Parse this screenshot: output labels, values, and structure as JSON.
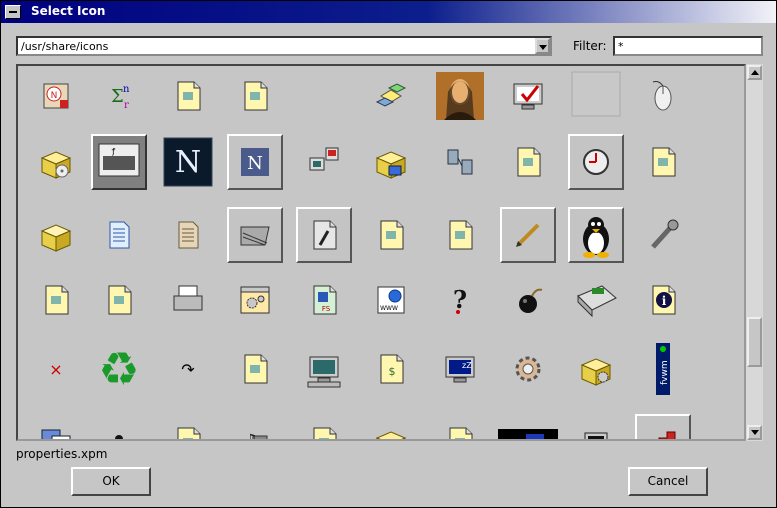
{
  "window": {
    "title": "Select Icon"
  },
  "path": {
    "value": "/usr/share/icons"
  },
  "filter": {
    "label": "Filter:",
    "value": "*"
  },
  "icons": [
    {
      "name": "compass-box-icon",
      "style": "plain"
    },
    {
      "name": "math-sigma-icon",
      "style": "plain",
      "text": "Σ",
      "sup": "n",
      "sub": "r"
    },
    {
      "name": "doc-bug-icon",
      "style": "plain"
    },
    {
      "name": "doc-grid-icon",
      "style": "plain"
    },
    {
      "name": "empty-slot",
      "style": "plain"
    },
    {
      "name": "cubes-icon",
      "style": "plain"
    },
    {
      "name": "mona-lisa-icon",
      "style": "plain"
    },
    {
      "name": "monitor-check-icon",
      "style": "plain"
    },
    {
      "name": "blank-card-icon",
      "style": "plain"
    },
    {
      "name": "mouse-icon",
      "style": "plain"
    },
    {
      "name": "package-cd-icon",
      "style": "plain"
    },
    {
      "name": "hardware-keyboard-icon",
      "style": "selected"
    },
    {
      "name": "netscape-icon",
      "style": "plain",
      "text": "N"
    },
    {
      "name": "netscape-small-icon",
      "style": "button",
      "text": "N"
    },
    {
      "name": "network-computers-icon",
      "style": "plain"
    },
    {
      "name": "package-monitor-icon",
      "style": "plain"
    },
    {
      "name": "network-servers-icon",
      "style": "plain"
    },
    {
      "name": "doc-yellow-icon",
      "style": "plain"
    },
    {
      "name": "clock-icon",
      "style": "button"
    },
    {
      "name": "doc-yellow-2-icon",
      "style": "plain"
    },
    {
      "name": "open-box-icon",
      "style": "plain"
    },
    {
      "name": "text-file-icon",
      "style": "plain"
    },
    {
      "name": "document-icon",
      "style": "plain"
    },
    {
      "name": "desk-icon",
      "style": "button"
    },
    {
      "name": "file-pen-icon",
      "style": "button"
    },
    {
      "name": "hand-doc-icon",
      "style": "plain"
    },
    {
      "name": "pdf-doc-icon",
      "style": "plain"
    },
    {
      "name": "pencil-icon",
      "style": "button"
    },
    {
      "name": "tux-penguin-icon",
      "style": "button"
    },
    {
      "name": "wrench-icon",
      "style": "plain"
    },
    {
      "name": "gnome-foot-icon",
      "style": "plain"
    },
    {
      "name": "doc-hand-icon",
      "style": "plain"
    },
    {
      "name": "printer-icon",
      "style": "plain"
    },
    {
      "name": "window-gears-icon",
      "style": "plain"
    },
    {
      "name": "fs-doc-icon",
      "style": "plain",
      "text": "FS"
    },
    {
      "name": "www-doc-icon",
      "style": "plain",
      "text": "WWW"
    },
    {
      "name": "help-question-icon",
      "style": "plain",
      "text": "?"
    },
    {
      "name": "bomb-icon",
      "style": "plain"
    },
    {
      "name": "calculator-icon",
      "style": "plain"
    },
    {
      "name": "info-doc-icon",
      "style": "plain",
      "text": "i"
    },
    {
      "name": "close-x-icon",
      "style": "plain",
      "text": "×"
    },
    {
      "name": "recycle-icon",
      "style": "plain",
      "text": "♻"
    },
    {
      "name": "curved-arrow-icon",
      "style": "plain",
      "text": "↷"
    },
    {
      "name": "doc-screen-icon",
      "style": "plain"
    },
    {
      "name": "computer-icon",
      "style": "plain"
    },
    {
      "name": "doc-dollar-icon",
      "style": "plain",
      "text": "$"
    },
    {
      "name": "monitor-sleep-icon",
      "style": "plain",
      "text": "zZ"
    },
    {
      "name": "settings-gear-icon",
      "style": "plain"
    },
    {
      "name": "package-gear-icon",
      "style": "plain"
    },
    {
      "name": "fvwm-logo-icon",
      "style": "plain",
      "text": "fvwm"
    },
    {
      "name": "windows-stack-icon",
      "style": "plain"
    },
    {
      "name": "ladybug-icon",
      "style": "plain"
    },
    {
      "name": "doc-pages-icon",
      "style": "plain"
    },
    {
      "name": "music-notes-icon",
      "style": "plain"
    },
    {
      "name": "wizard-window-icon",
      "style": "plain"
    },
    {
      "name": "package-open-icon",
      "style": "plain"
    },
    {
      "name": "plug-icon",
      "style": "plain"
    },
    {
      "name": "terminal-dark-icon",
      "style": "plain"
    },
    {
      "name": "small-terminal-icon",
      "style": "plain"
    },
    {
      "name": "stairs-icon",
      "style": "button"
    }
  ],
  "status": {
    "filename": "properties.xpm"
  },
  "buttons": {
    "ok": "OK",
    "cancel": "Cancel"
  }
}
